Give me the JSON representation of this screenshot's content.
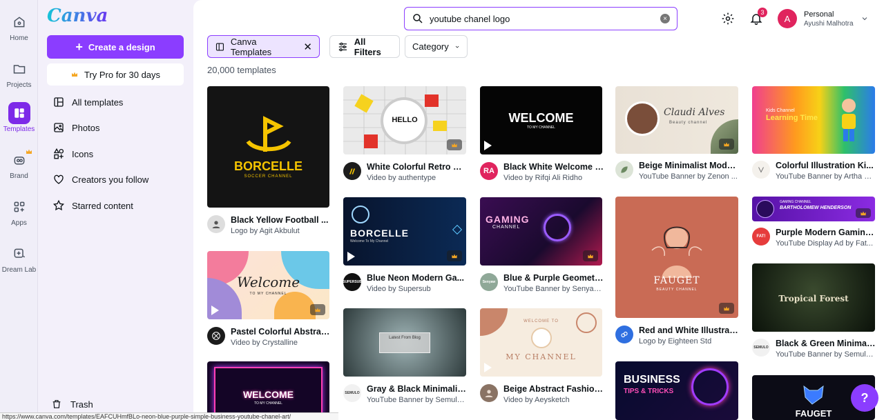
{
  "colors": {
    "accent": "#8b3dff",
    "badge": "#e0245e"
  },
  "rail": {
    "items": [
      {
        "label": "Home",
        "icon": "home-icon"
      },
      {
        "label": "Projects",
        "icon": "folder-icon"
      },
      {
        "label": "Templates",
        "icon": "templates-icon"
      },
      {
        "label": "Brand",
        "icon": "brand-icon"
      },
      {
        "label": "Apps",
        "icon": "apps-icon"
      },
      {
        "label": "Dream Lab",
        "icon": "dream-lab-icon"
      }
    ]
  },
  "panel": {
    "logo": "Canva",
    "create_label": "Create a design",
    "pro_label": "Try Pro for 30 days",
    "nav": [
      {
        "label": "All templates",
        "icon": "template-icon"
      },
      {
        "label": "Photos",
        "icon": "photo-icon"
      },
      {
        "label": "Icons",
        "icon": "shapes-icon"
      },
      {
        "label": "Creators you follow",
        "icon": "heart-icon"
      },
      {
        "label": "Starred content",
        "icon": "star-icon"
      }
    ],
    "trash_label": "Trash"
  },
  "header": {
    "search_value": "youtube chanel logo",
    "notification_count": "3",
    "account_type": "Personal",
    "account_name": "Ayushi Malhotra"
  },
  "filters": {
    "selected_chip": "Canva Templates",
    "all_filters": "All Filters",
    "category": "Category",
    "result_count": "20,000 templates"
  },
  "cards": [
    {
      "title": "Black Yellow Football ...",
      "sub": "Logo by Agit Akbulut",
      "thumb_text": "BORCELLE",
      "thumb_sub": "SOCCER CHANNEL"
    },
    {
      "title": "Pastel Colorful Abstrac...",
      "sub": "Video by Crystalline",
      "thumb_text": "Welcome",
      "thumb_sub": "TO MY CHANNEL"
    },
    {
      "title": "",
      "sub": "",
      "thumb_text": "WELCOME",
      "thumb_sub": "TO MY CHANNEL"
    },
    {
      "title": "White Colorful Retro Vi...",
      "sub": "Video by authentype",
      "thumb_text": "HELLO",
      "thumb_sub": ""
    },
    {
      "title": "Blue Neon Modern Ga...",
      "sub": "Video by Supersub",
      "thumb_text": "BORCELLE",
      "thumb_sub": "Welcome To My Channel"
    },
    {
      "title": "Gray & Black Minimalis...",
      "sub": "YouTube Banner by Semula...",
      "thumb_text": "Latest From Blog",
      "thumb_sub": ""
    },
    {
      "title": "Black White Welcome T...",
      "sub": "Video by Rifqi Ali Ridho",
      "thumb_text": "WELCOME",
      "thumb_sub": "TO MY CHANNEL"
    },
    {
      "title": "Blue & Purple Geometr...",
      "sub": "YouTube Banner by Senyaw...",
      "thumb_text": "GAMING",
      "thumb_sub": "CHANNEL"
    },
    {
      "title": "Beige Abstract Fashion...",
      "sub": "Video by Aeysketch",
      "thumb_text": "MY CHANNEL",
      "thumb_sub": "WELCOME TO"
    },
    {
      "title": "Beige Minimalist Mode...",
      "sub": "YouTube Banner by Zenon ...",
      "thumb_text": "Claudi Alves",
      "thumb_sub": "Beauty channel"
    },
    {
      "title": "Red and White Illustrat...",
      "sub": "Logo by Eighteen Std",
      "thumb_text": "FAUGET",
      "thumb_sub": "BEAUTY CHANNEL"
    },
    {
      "title": "",
      "sub": "",
      "thumb_text": "BUSINESS",
      "thumb_sub": "TIPS & TRICKS"
    },
    {
      "title": "Colorful Illustration Ki...",
      "sub": "YouTube Banner by Artha G...",
      "thumb_text": "Learning Time",
      "thumb_sub": "Kids Channel"
    },
    {
      "title": "Purple Modern Gaming...",
      "sub": "YouTube Display Ad by Fat...",
      "thumb_text": "BARTHOLOMEW HENDERSON",
      "thumb_sub": "GAMING CHANNEL"
    },
    {
      "title": "Black & Green Minimali...",
      "sub": "YouTube Banner by Semula...",
      "thumb_text": "Tropical Forest",
      "thumb_sub": ""
    },
    {
      "title": "",
      "sub": "",
      "thumb_text": "FAUGET",
      "thumb_sub": ""
    }
  ],
  "card_avatars": [
    "",
    "",
    "",
    "",
    "SUPERSUB",
    "SEMULO",
    "RA",
    "Senyaw",
    "",
    "",
    "",
    "",
    "",
    "FAT!",
    "SEMULO",
    ""
  ],
  "help_label": "?",
  "status_url": "https://www.canva.com/templates/EAFCUHmfBLo-neon-blue-purple-simple-business-youtube-chanel-art/"
}
